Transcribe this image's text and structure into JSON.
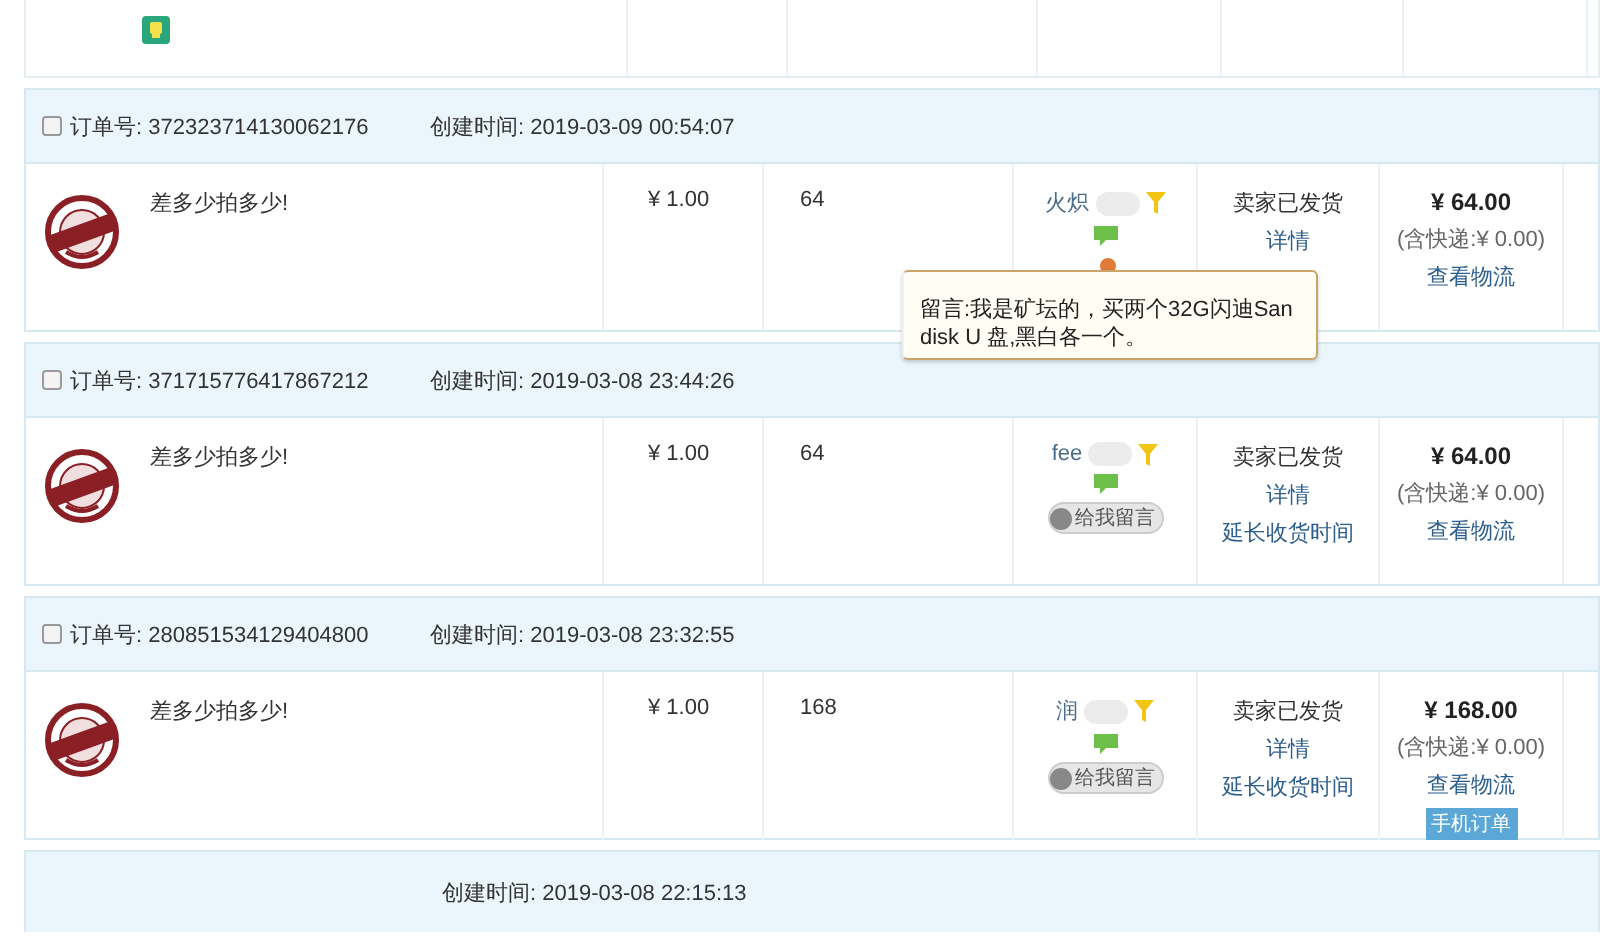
{
  "orders": [
    {
      "checked": false,
      "order_label": "订单号:",
      "order_no": "372323714130062176",
      "created_label": "创建时间:",
      "created": "2019-03-09 00:54:07",
      "title": "差多少拍多少!",
      "price": "¥ 1.00",
      "quantity": "64",
      "buyer": "火炽",
      "status": "卖家已发货",
      "links": [
        "详情"
      ],
      "total": "¥ 64.00",
      "shipping": "(含快递:¥ 0.00)",
      "logistics": "查看物流",
      "tooltip": "留言:我是矿坛的，买两个32G闪迪Sandisk U 盘,黑白各一个。"
    },
    {
      "checked": false,
      "order_label": "订单号:",
      "order_no": "371715776417867212",
      "created_label": "创建时间:",
      "created": "2019-03-08 23:44:26",
      "title": "差多少拍多少!",
      "price": "¥ 1.00",
      "quantity": "64",
      "buyer": "fee",
      "status": "卖家已发货",
      "links": [
        "详情",
        "延长收货时间"
      ],
      "total": "¥ 64.00",
      "shipping": "(含快递:¥ 0.00)",
      "logistics": "查看物流",
      "message_button": "给我留言"
    },
    {
      "checked": false,
      "order_label": "订单号:",
      "order_no": "280851534129404800",
      "created_label": "创建时间:",
      "created": "2019-03-08 23:32:55",
      "title": "差多少拍多少!",
      "price": "¥ 1.00",
      "quantity": "168",
      "buyer": "润",
      "status": "卖家已发货",
      "links": [
        "详情",
        "延长收货时间"
      ],
      "total": "¥ 168.00",
      "shipping": "(含快递:¥ 0.00)",
      "logistics": "查看物流",
      "message_button": "给我留言",
      "mobile_badge": "手机订单"
    }
  ],
  "last_header": {
    "created_label": "创建时间:",
    "created": "2019-03-08 22:15:13"
  }
}
